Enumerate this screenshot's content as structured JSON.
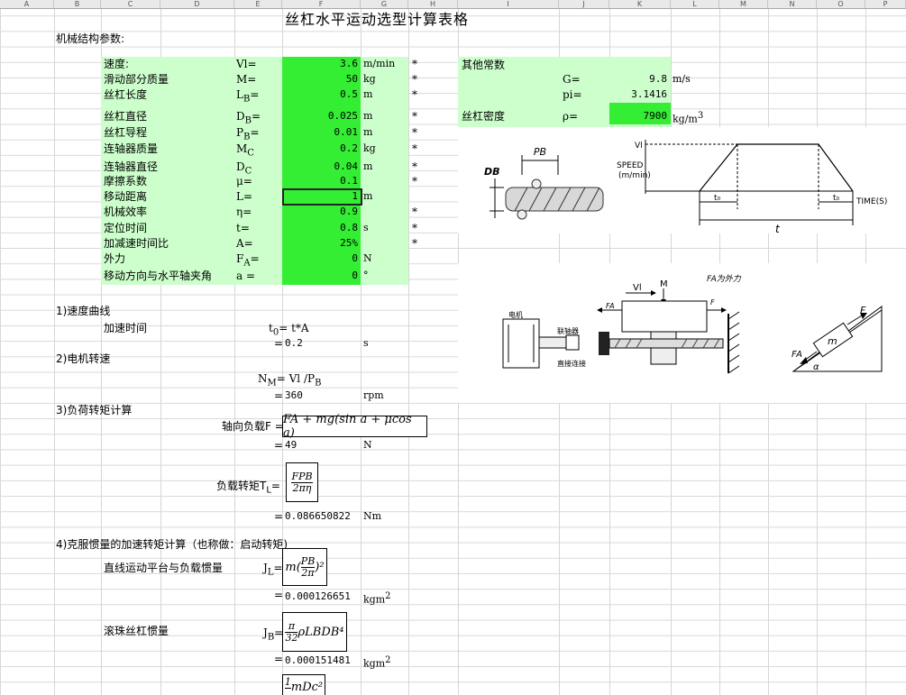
{
  "columns": [
    "A",
    "B",
    "C",
    "D",
    "E",
    "F",
    "G",
    "H",
    "I",
    "J",
    "K",
    "L",
    "M",
    "N",
    "O",
    "P"
  ],
  "title": "丝杠水平运动选型计算表格",
  "section_params": "机械结构参数:",
  "params": [
    {
      "label": "速度:",
      "sym": "Vl=",
      "value": "3.6",
      "unit": "m/min",
      "star": "*"
    },
    {
      "label": "滑动部分质量",
      "sym": "M=",
      "value": "50",
      "unit": "kg",
      "star": "*"
    },
    {
      "label": "丝杠长度",
      "sym": "L",
      "sub": "B",
      "eq": "=",
      "value": "0.5",
      "unit": "m",
      "star": "*"
    },
    {
      "label": "丝杠直径",
      "sym": "D",
      "sub": "B",
      "eq": "=",
      "value": "0.025",
      "unit": "m",
      "star": "*"
    },
    {
      "label": "丝杠导程",
      "sym": "P",
      "sub": "B",
      "eq": "=",
      "value": "0.01",
      "unit": "m",
      "star": "*"
    },
    {
      "label": "连轴器质量",
      "sym": "M",
      "sub": "C",
      "eq": "",
      "value": "0.2",
      "unit": "kg",
      "star": "*"
    },
    {
      "label": "连轴器直径",
      "sym": "D",
      "sub": "C",
      "eq": "",
      "value": "0.04",
      "unit": "m",
      "star": "*"
    },
    {
      "label": "摩擦系数",
      "sym": "μ=",
      "value": "0.1",
      "unit": "",
      "star": "*"
    },
    {
      "label": "移动距离",
      "sym": "L=",
      "value": "1",
      "unit": "m",
      "star": ""
    },
    {
      "label": "机械效率",
      "sym": "η=",
      "value": "0.9",
      "unit": "",
      "star": "*"
    },
    {
      "label": "定位时间",
      "sym": "t=",
      "value": "0.8",
      "unit": "s",
      "star": "*"
    },
    {
      "label": "加减速时间比",
      "sym": "A=",
      "value": "25%",
      "unit": "",
      "star": "*"
    },
    {
      "label": "外力",
      "sym": "F",
      "sub": "A",
      "eq": "=",
      "value": "0",
      "unit": "N",
      "star": ""
    },
    {
      "label": "移动方向与水平轴夹角",
      "sym": "a =",
      "value": "0",
      "unit": "°",
      "star": ""
    }
  ],
  "other": {
    "title": "其他常数",
    "g_sym": "G=",
    "g_val": "9.8",
    "g_unit": "m/s",
    "pi_sym": "pi=",
    "pi_val": "3.1416",
    "rho_label": "丝杠密度",
    "rho_sym": "ρ=",
    "rho_val": "7900",
    "rho_unit": "kg/m",
    "rho_exp": "3"
  },
  "s1": {
    "title": "1)速度曲线",
    "label": "加速时间",
    "sym": "t",
    "sub": "0",
    "formula": "= t*A",
    "eq": "=",
    "result": "0.2",
    "unit": "s"
  },
  "s2": {
    "title": "2)电机转速",
    "sym": "N",
    "sub": "M",
    "formula": "= Vl /P",
    "fsub": "B",
    "eq": "=",
    "result": "360",
    "unit": "rpm"
  },
  "s3": {
    "title": "3)负荷转矩计算",
    "axial_label": "轴向负载F =",
    "axial_formula": "FA + mg(sin a + μcos a)",
    "eq": "=",
    "axial_result": "49",
    "axial_unit": "N",
    "torque_label": "负载转矩T",
    "torque_sub": "L",
    "torque_eq": "=",
    "torque_num": "FPB",
    "torque_den": "2πη",
    "torque_result": "0.086650822",
    "torque_unit": "Nm"
  },
  "s4": {
    "title": "4)克服惯量的加速转矩计算（也称做：启动转矩)",
    "jl_label": "直线运动平台与负载惯量",
    "jl_sym": "J",
    "jl_sub": "L",
    "jl_eq": "=",
    "jl_formula_pre": "m(",
    "jl_num": "PB",
    "jl_den": "2π",
    "jl_formula_post": ")²",
    "jl_result": "0.000126651",
    "jl_unit": "kgm",
    "jb_label": "滚珠丝杠惯量",
    "jb_sym": "J",
    "jb_sub": "B",
    "jb_eq": "=",
    "jb_num": "π",
    "jb_den": "32",
    "jb_formula_post": "ρLBDB⁴",
    "jb_result": "0.000151481",
    "jb_unit": "kgm",
    "jc_num": "1",
    "jc_formula_post": "mDc²"
  },
  "diagrams": {
    "screw_pb": "PB",
    "screw_db": "DB",
    "speed_vl": "Vl",
    "speed_label": "SPEED",
    "speed_unit": "(m/min)",
    "speed_t0a": "t₀",
    "speed_t0b": "t₀",
    "speed_time": "TIME(S)",
    "speed_t": "t",
    "mech_vl": "Vl",
    "mech_m": "M",
    "mech_fa": "FA",
    "mech_f": "F",
    "mech_note": "FA为外力",
    "mech_motor": "电机",
    "mech_coupling": "联轴器",
    "mech_direct": "直接连接",
    "incline_m": "m",
    "incline_f": "F",
    "incline_fa": "FA",
    "incline_a": "α"
  },
  "colors": {
    "light_green": "#ccffcc",
    "green": "#33ee33"
  }
}
